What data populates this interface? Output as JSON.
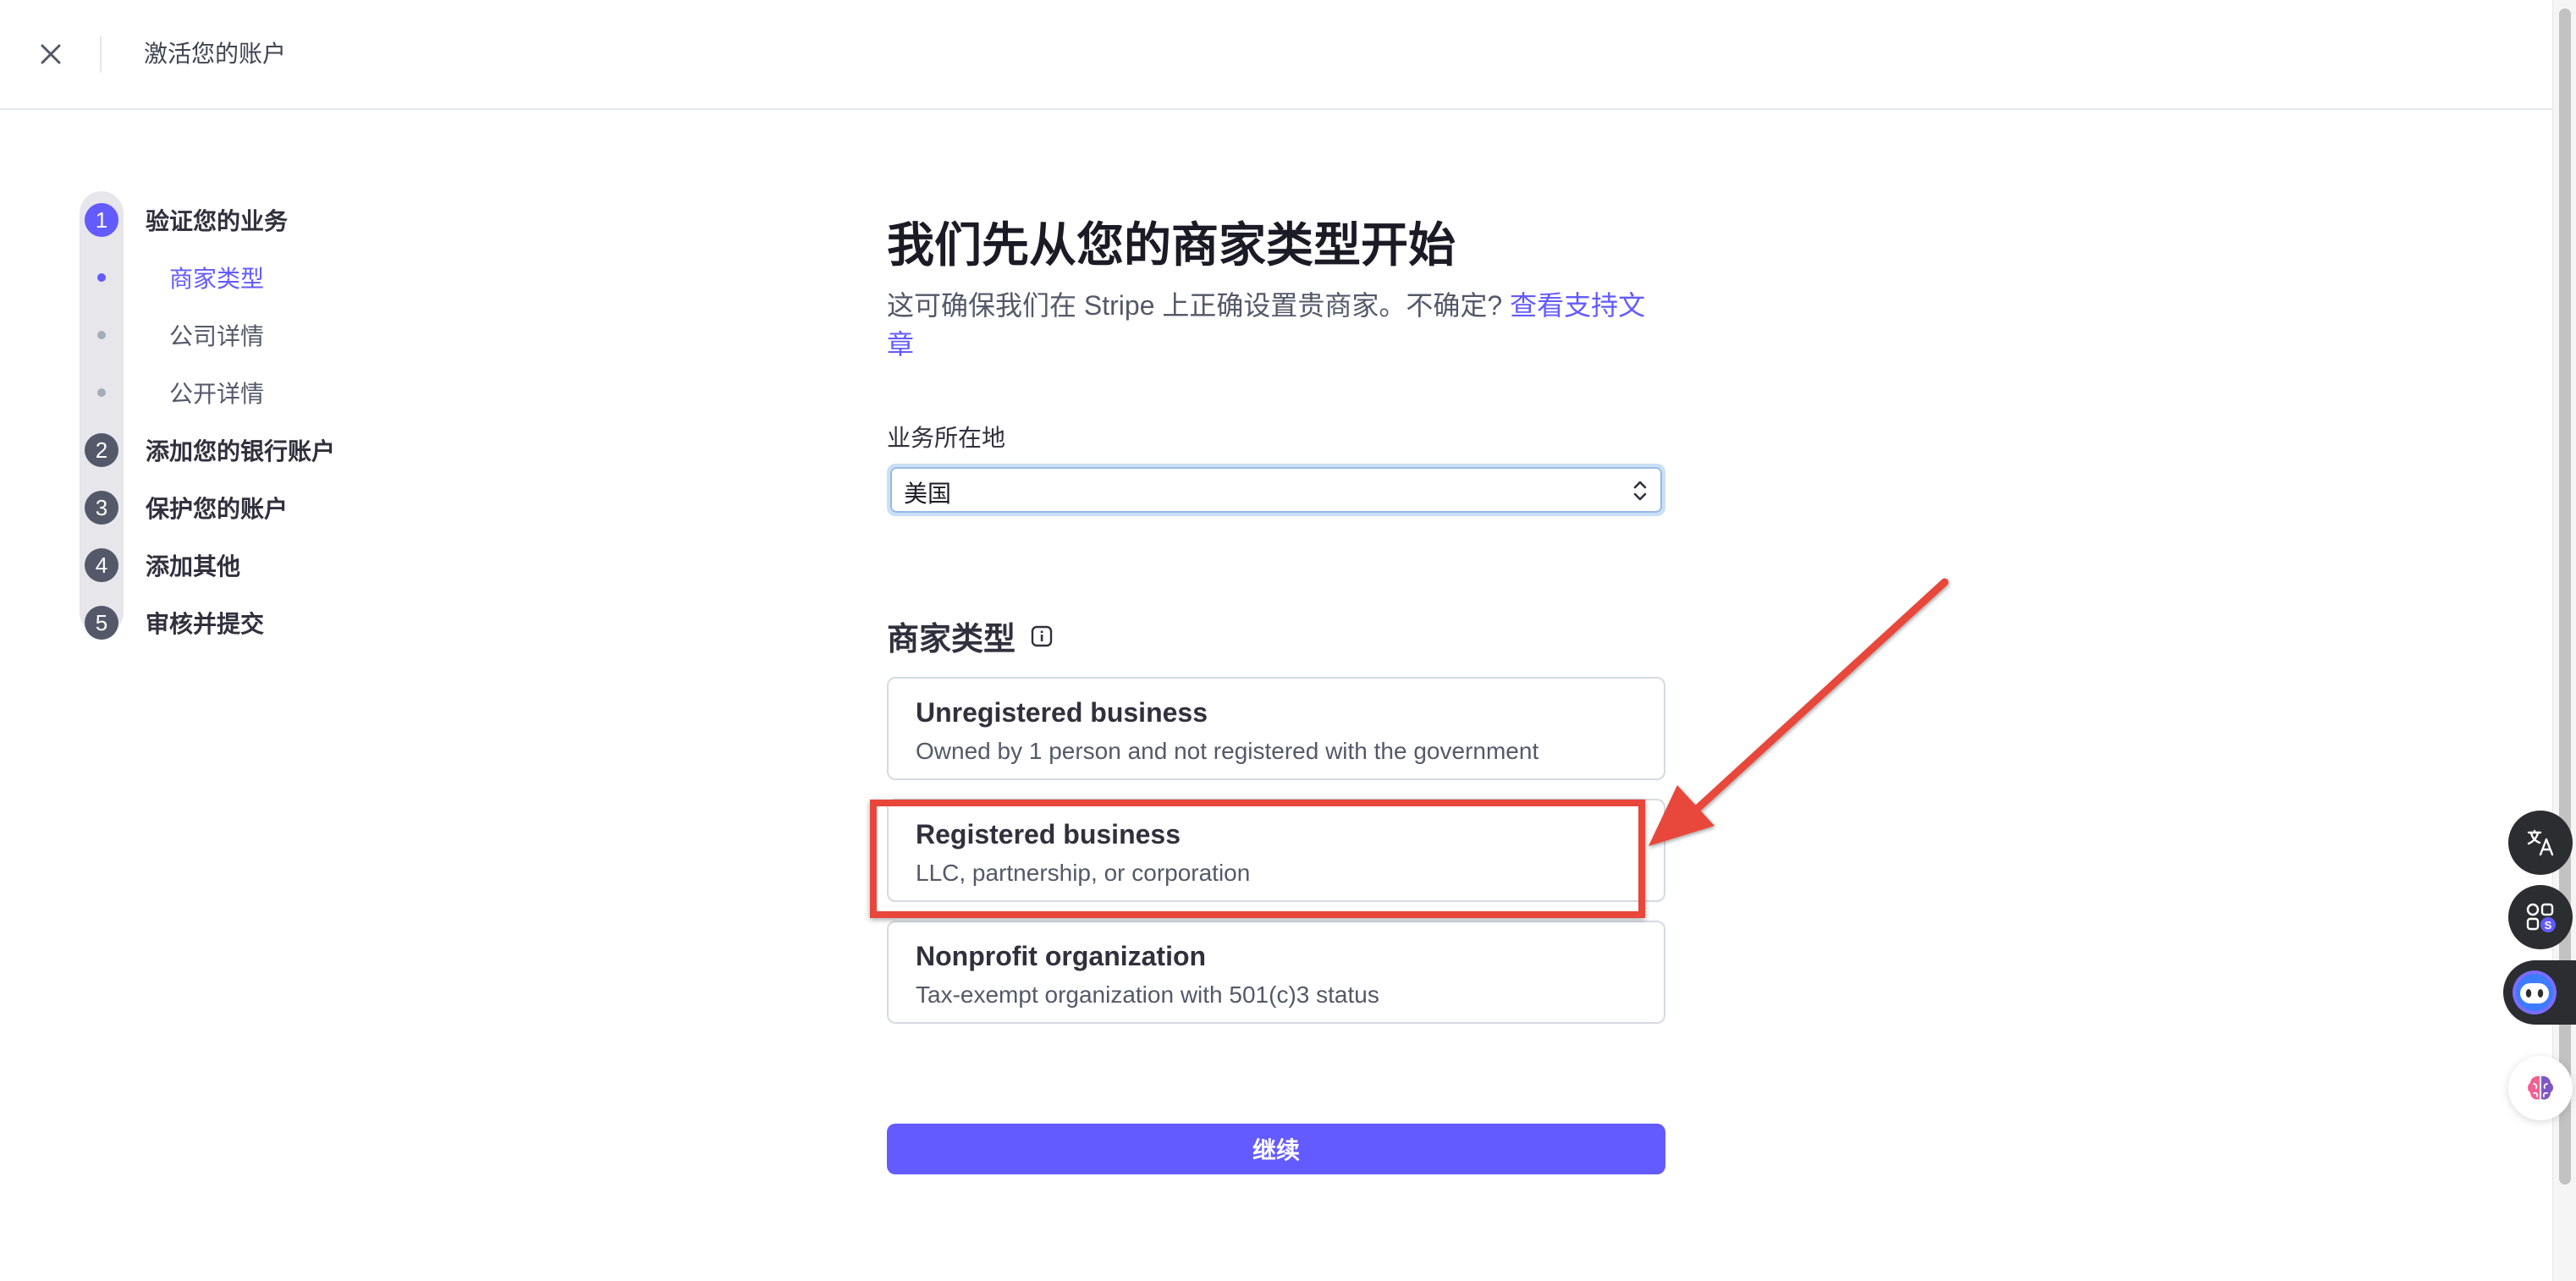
{
  "header": {
    "title": "激活您的账户"
  },
  "stepper": {
    "steps": [
      {
        "number": "1",
        "label": "验证您的业务",
        "active": true
      },
      {
        "number": "2",
        "label": "添加您的银行账户"
      },
      {
        "number": "3",
        "label": "保护您的账户"
      },
      {
        "number": "4",
        "label": "添加其他"
      },
      {
        "number": "5",
        "label": "审核并提交"
      }
    ],
    "substeps": [
      {
        "label": "商家类型",
        "active": true
      },
      {
        "label": "公司详情"
      },
      {
        "label": "公开详情"
      }
    ]
  },
  "main": {
    "title": "我们先从您的商家类型开始",
    "subtitle": "这可确保我们在 Stripe 上正确设置贵商家。不确定?",
    "subtitle_link": "查看支持文章",
    "location_label": "业务所在地",
    "location_value": "美国",
    "business_type_title": "商家类型",
    "options": [
      {
        "title": "Unregistered business",
        "desc": "Owned by 1 person and not registered with the government"
      },
      {
        "title": "Registered business",
        "desc": "LLC, partnership, or corporation",
        "highlighted": true
      },
      {
        "title": "Nonprofit organization",
        "desc": "Tax-exempt organization with 501(c)3 status"
      }
    ],
    "continue_label": "继续"
  },
  "colors": {
    "accent": "#635bff",
    "annotation": "#e8463a",
    "text": "#30313d",
    "muted": "#545969"
  },
  "side_tools": [
    "translate-icon",
    "apps-icon",
    "bot-icon",
    "brain-icon"
  ]
}
